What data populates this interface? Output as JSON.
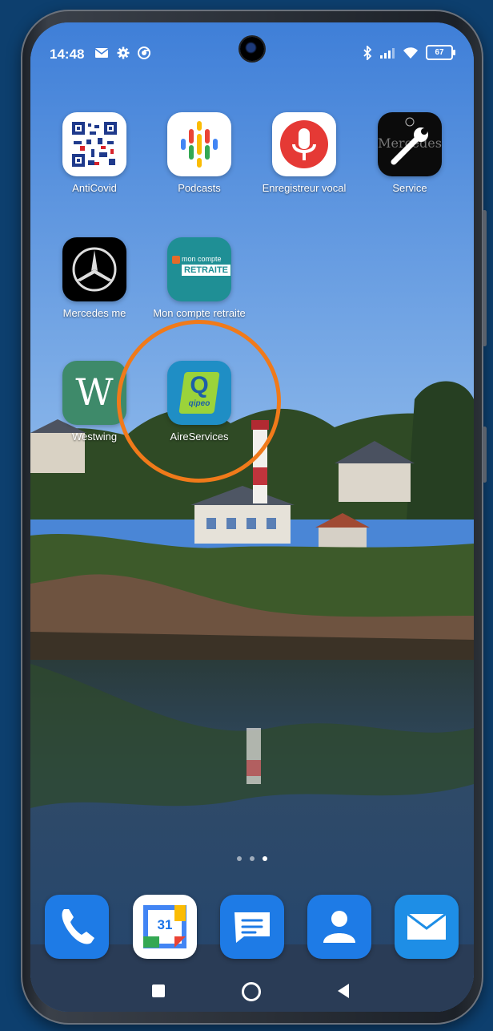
{
  "status_bar": {
    "time": "14:48",
    "battery": "67",
    "left_icons": [
      "mail-icon",
      "settings-icon",
      "chrome-icon"
    ],
    "right_icons": [
      "bluetooth-icon",
      "signal-icon",
      "wifi-icon",
      "battery-icon"
    ]
  },
  "home_apps": [
    {
      "name": "AntiCovid",
      "icon": "anticovid-qr-icon"
    },
    {
      "name": "Podcasts",
      "icon": "google-podcasts-icon"
    },
    {
      "name": "Enregistreur vocal",
      "icon": "voice-recorder-icon"
    },
    {
      "name": "Service",
      "icon": "mercedes-service-icon",
      "icon_text": "Mercedes"
    },
    {
      "name": "Mercedes me",
      "icon": "mercedes-star-icon"
    },
    {
      "name": "Mon compte retraite",
      "icon": "mon-compte-retraite-icon",
      "icon_text_top": "mon compte",
      "icon_text_main": "RETRAITE"
    },
    {
      "name": "Westwing",
      "icon": "westwing-icon",
      "icon_text": "W"
    },
    {
      "name": "AireServices",
      "icon": "qipeo-icon",
      "icon_text_main": "Q",
      "icon_text_sub": "qipeo"
    }
  ],
  "page_indicator": {
    "count": 3,
    "active": 3
  },
  "dock": {
    "phone": "phone-icon",
    "calendar": "31",
    "messages": "messages-icon",
    "contacts": "contacts-icon",
    "email": "email-icon"
  },
  "nav": [
    "recents-icon",
    "home-icon",
    "back-icon"
  ],
  "colors": {
    "highlight": "#f07a1a",
    "sky": "#4a86d6",
    "background": "#0d3f6e"
  }
}
